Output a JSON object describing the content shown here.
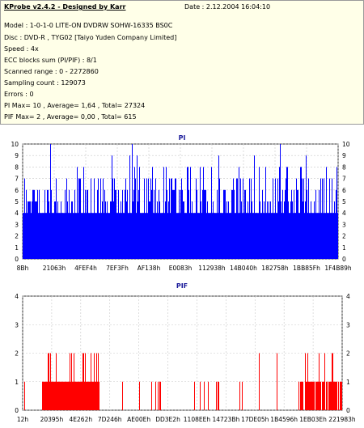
{
  "info": {
    "title": "KProbe v2.4.2 - Designed by Karr",
    "date": "Date : 2.12.2004 16:04:10",
    "model": "Model : 1-0-1-0 LITE-ON DVDRW SOHW-16335 BS0C",
    "disc": "Disc : DVD-R , TYG02 [Taiyo Yuden Company Limited]",
    "speed": "Speed : 4x",
    "ecc": "ECC blocks sum (PI/PIF) : 8/1",
    "scanned": "Scanned range : 0 - 2272860",
    "sampling": "Sampling count : 129073",
    "errors": "Errors : 0",
    "pi_stats": "PI Max= 10 , Average= 1,64 , Total= 27324",
    "pif_stats": "PIF Max= 2 , Average= 0,00 , Total= 615"
  },
  "chart_data": [
    {
      "type": "bar",
      "title": "PI",
      "ylim": [
        0,
        10
      ],
      "yticks": [
        "0",
        "1",
        "2",
        "3",
        "4",
        "5",
        "6",
        "7",
        "8",
        "9",
        "10"
      ],
      "xticks": [
        "8Bh",
        "21063h",
        "4FEF4h",
        "7EF3Fh",
        "AF138h",
        "E0083h",
        "112938h",
        "14B040h",
        "182758h",
        "1BB85Fh",
        "1F4B89h"
      ],
      "baseline_value": 4,
      "max": 10,
      "color": "#0000ff",
      "grid": true
    },
    {
      "type": "bar",
      "title": "PIF",
      "ylim": [
        0,
        4
      ],
      "yticks": [
        "0",
        "1",
        "2",
        "3",
        "4"
      ],
      "xticks": [
        "12h",
        "20395h",
        "4E262h",
        "7D246h",
        "AE00Eh",
        "DD3E2h",
        "1108EEh",
        "14723Bh",
        "17DE05h",
        "1B4596h",
        "1EB03Eh",
        "221983h"
      ],
      "max": 2,
      "color": "#ff0000",
      "grid": true
    }
  ]
}
